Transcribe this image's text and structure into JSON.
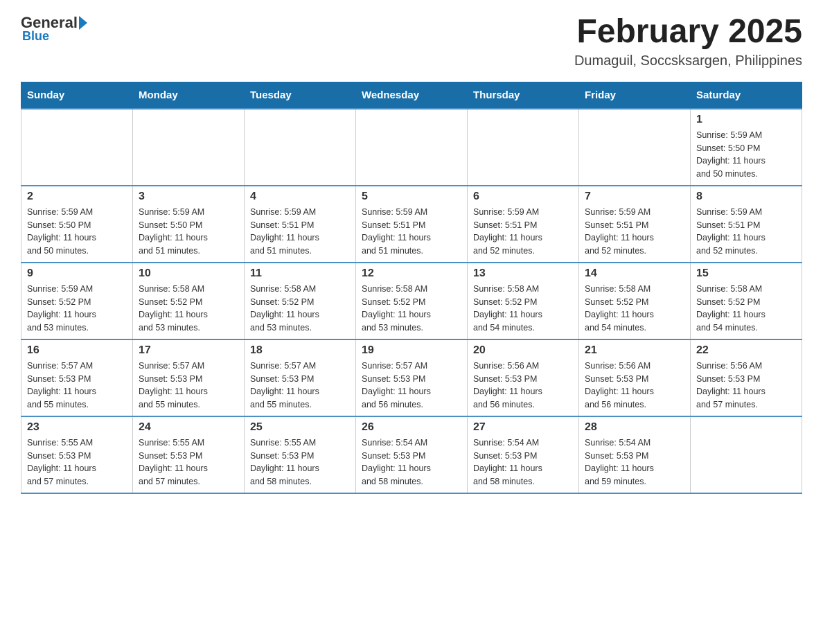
{
  "logo": {
    "general": "General",
    "blue": "Blue"
  },
  "title": "February 2025",
  "subtitle": "Dumaguil, Soccsksargen, Philippines",
  "days_of_week": [
    "Sunday",
    "Monday",
    "Tuesday",
    "Wednesday",
    "Thursday",
    "Friday",
    "Saturday"
  ],
  "weeks": [
    [
      {
        "day": "",
        "info": ""
      },
      {
        "day": "",
        "info": ""
      },
      {
        "day": "",
        "info": ""
      },
      {
        "day": "",
        "info": ""
      },
      {
        "day": "",
        "info": ""
      },
      {
        "day": "",
        "info": ""
      },
      {
        "day": "1",
        "info": "Sunrise: 5:59 AM\nSunset: 5:50 PM\nDaylight: 11 hours\nand 50 minutes."
      }
    ],
    [
      {
        "day": "2",
        "info": "Sunrise: 5:59 AM\nSunset: 5:50 PM\nDaylight: 11 hours\nand 50 minutes."
      },
      {
        "day": "3",
        "info": "Sunrise: 5:59 AM\nSunset: 5:50 PM\nDaylight: 11 hours\nand 51 minutes."
      },
      {
        "day": "4",
        "info": "Sunrise: 5:59 AM\nSunset: 5:51 PM\nDaylight: 11 hours\nand 51 minutes."
      },
      {
        "day": "5",
        "info": "Sunrise: 5:59 AM\nSunset: 5:51 PM\nDaylight: 11 hours\nand 51 minutes."
      },
      {
        "day": "6",
        "info": "Sunrise: 5:59 AM\nSunset: 5:51 PM\nDaylight: 11 hours\nand 52 minutes."
      },
      {
        "day": "7",
        "info": "Sunrise: 5:59 AM\nSunset: 5:51 PM\nDaylight: 11 hours\nand 52 minutes."
      },
      {
        "day": "8",
        "info": "Sunrise: 5:59 AM\nSunset: 5:51 PM\nDaylight: 11 hours\nand 52 minutes."
      }
    ],
    [
      {
        "day": "9",
        "info": "Sunrise: 5:59 AM\nSunset: 5:52 PM\nDaylight: 11 hours\nand 53 minutes."
      },
      {
        "day": "10",
        "info": "Sunrise: 5:58 AM\nSunset: 5:52 PM\nDaylight: 11 hours\nand 53 minutes."
      },
      {
        "day": "11",
        "info": "Sunrise: 5:58 AM\nSunset: 5:52 PM\nDaylight: 11 hours\nand 53 minutes."
      },
      {
        "day": "12",
        "info": "Sunrise: 5:58 AM\nSunset: 5:52 PM\nDaylight: 11 hours\nand 53 minutes."
      },
      {
        "day": "13",
        "info": "Sunrise: 5:58 AM\nSunset: 5:52 PM\nDaylight: 11 hours\nand 54 minutes."
      },
      {
        "day": "14",
        "info": "Sunrise: 5:58 AM\nSunset: 5:52 PM\nDaylight: 11 hours\nand 54 minutes."
      },
      {
        "day": "15",
        "info": "Sunrise: 5:58 AM\nSunset: 5:52 PM\nDaylight: 11 hours\nand 54 minutes."
      }
    ],
    [
      {
        "day": "16",
        "info": "Sunrise: 5:57 AM\nSunset: 5:53 PM\nDaylight: 11 hours\nand 55 minutes."
      },
      {
        "day": "17",
        "info": "Sunrise: 5:57 AM\nSunset: 5:53 PM\nDaylight: 11 hours\nand 55 minutes."
      },
      {
        "day": "18",
        "info": "Sunrise: 5:57 AM\nSunset: 5:53 PM\nDaylight: 11 hours\nand 55 minutes."
      },
      {
        "day": "19",
        "info": "Sunrise: 5:57 AM\nSunset: 5:53 PM\nDaylight: 11 hours\nand 56 minutes."
      },
      {
        "day": "20",
        "info": "Sunrise: 5:56 AM\nSunset: 5:53 PM\nDaylight: 11 hours\nand 56 minutes."
      },
      {
        "day": "21",
        "info": "Sunrise: 5:56 AM\nSunset: 5:53 PM\nDaylight: 11 hours\nand 56 minutes."
      },
      {
        "day": "22",
        "info": "Sunrise: 5:56 AM\nSunset: 5:53 PM\nDaylight: 11 hours\nand 57 minutes."
      }
    ],
    [
      {
        "day": "23",
        "info": "Sunrise: 5:55 AM\nSunset: 5:53 PM\nDaylight: 11 hours\nand 57 minutes."
      },
      {
        "day": "24",
        "info": "Sunrise: 5:55 AM\nSunset: 5:53 PM\nDaylight: 11 hours\nand 57 minutes."
      },
      {
        "day": "25",
        "info": "Sunrise: 5:55 AM\nSunset: 5:53 PM\nDaylight: 11 hours\nand 58 minutes."
      },
      {
        "day": "26",
        "info": "Sunrise: 5:54 AM\nSunset: 5:53 PM\nDaylight: 11 hours\nand 58 minutes."
      },
      {
        "day": "27",
        "info": "Sunrise: 5:54 AM\nSunset: 5:53 PM\nDaylight: 11 hours\nand 58 minutes."
      },
      {
        "day": "28",
        "info": "Sunrise: 5:54 AM\nSunset: 5:53 PM\nDaylight: 11 hours\nand 59 minutes."
      },
      {
        "day": "",
        "info": ""
      }
    ]
  ]
}
